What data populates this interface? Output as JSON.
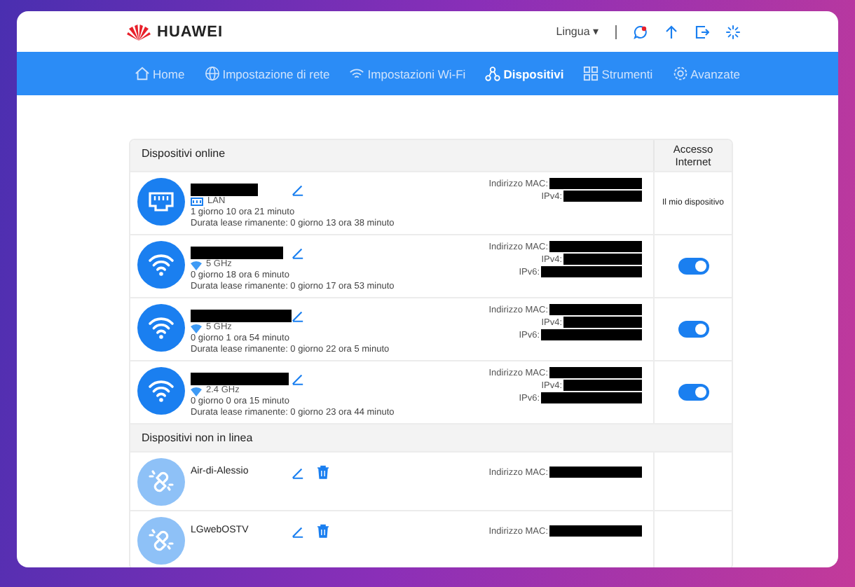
{
  "brand": {
    "name": "HUAWEI"
  },
  "header": {
    "language": "Lingua",
    "language_caret": "▾"
  },
  "nav": [
    {
      "label": "Home",
      "selected": false
    },
    {
      "label": "Impostazione di rete",
      "selected": false
    },
    {
      "label": "Impostazioni Wi-Fi",
      "selected": false
    },
    {
      "label": "Dispositivi",
      "selected": true
    },
    {
      "label": "Strumenti",
      "selected": false
    },
    {
      "label": "Avanzate",
      "selected": false
    }
  ],
  "online": {
    "title": "Dispositivi online",
    "access_heading": "Accesso Internet",
    "devices": [
      {
        "kind": "lan",
        "connection": "LAN",
        "uptime": "1 giorno 10 ora 21 minuto",
        "lease": "Durata lease rimanente: 0 giorno 13 ora 38 minuto",
        "addresses": [
          "Indirizzo MAC:",
          "IPv4:"
        ],
        "access": {
          "kind": "text",
          "text": "Il mio dispositivo"
        }
      },
      {
        "kind": "wifi",
        "connection": "5 GHz",
        "uptime": "0 giorno 18 ora 6 minuto",
        "lease": "Durata lease rimanente: 0 giorno 17 ora 53 minuto",
        "addresses": [
          "Indirizzo MAC:",
          "IPv4:",
          "IPv6:"
        ],
        "access": {
          "kind": "toggle",
          "on": true
        }
      },
      {
        "kind": "wifi",
        "connection": "5 GHz",
        "uptime": "0 giorno 1 ora 54 minuto",
        "lease": "Durata lease rimanente: 0 giorno 22 ora 5 minuto",
        "addresses": [
          "Indirizzo MAC:",
          "IPv4:",
          "IPv6:"
        ],
        "access": {
          "kind": "toggle",
          "on": true
        }
      },
      {
        "kind": "wifi",
        "connection": "2.4 GHz",
        "uptime": "0 giorno 0 ora 15 minuto",
        "lease": "Durata lease rimanente: 0 giorno 23 ora 44 minuto",
        "addresses": [
          "Indirizzo MAC:",
          "IPv4:",
          "IPv6:"
        ],
        "access": {
          "kind": "toggle",
          "on": true
        }
      }
    ]
  },
  "offline": {
    "title": "Dispositivi non in linea",
    "devices": [
      {
        "name": "Air-di-Alessio",
        "addresses": [
          "Indirizzo MAC:"
        ]
      },
      {
        "name": "LGwebOSTV",
        "addresses": [
          "Indirizzo MAC:"
        ]
      }
    ]
  }
}
